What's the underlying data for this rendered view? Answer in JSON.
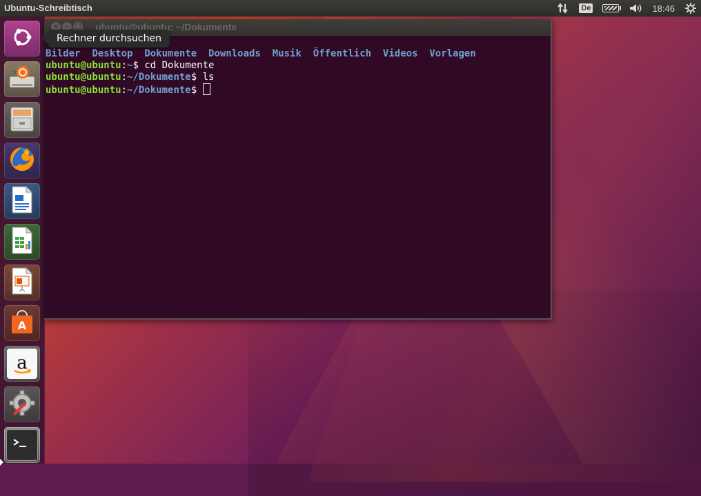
{
  "top_panel": {
    "title": "Ubuntu-Schreibtisch",
    "keyboard_layout": "De",
    "clock": "18:46"
  },
  "tooltip": {
    "text": "Rechner durchsuchen"
  },
  "launcher": {
    "items": [
      {
        "name": "dash-search",
        "icon": "ubuntu-logo-icon"
      },
      {
        "name": "installer",
        "icon": "install-drive-icon"
      },
      {
        "name": "files",
        "icon": "file-cabinet-icon"
      },
      {
        "name": "firefox",
        "icon": "firefox-icon"
      },
      {
        "name": "libreoffice-writer",
        "icon": "writer-icon"
      },
      {
        "name": "libreoffice-calc",
        "icon": "calc-icon"
      },
      {
        "name": "libreoffice-impress",
        "icon": "impress-icon"
      },
      {
        "name": "software-center",
        "icon": "shopping-bag-icon"
      },
      {
        "name": "amazon",
        "icon": "amazon-icon"
      },
      {
        "name": "system-settings",
        "icon": "settings-icon"
      },
      {
        "name": "terminal",
        "icon": "terminal-icon"
      }
    ]
  },
  "terminal": {
    "title": "ubuntu@ubuntu: ~/Dokumente",
    "ls_output": [
      "Bilder",
      "Desktop",
      "Dokumente",
      "Downloads",
      "Musik",
      "Öffentlich",
      "Videos",
      "Vorlagen"
    ],
    "lines": [
      {
        "user": "ubuntu@ubuntu",
        "path": "~",
        "cmd": "cd Dokumente"
      },
      {
        "user": "ubuntu@ubuntu",
        "path": "~/Dokumente",
        "cmd": "ls"
      },
      {
        "user": "ubuntu@ubuntu",
        "path": "~/Dokumente",
        "cmd": ""
      }
    ]
  },
  "colors": {
    "terminal_bg": "#300a24",
    "user_green": "#8ae234",
    "path_blue": "#729fcf"
  }
}
